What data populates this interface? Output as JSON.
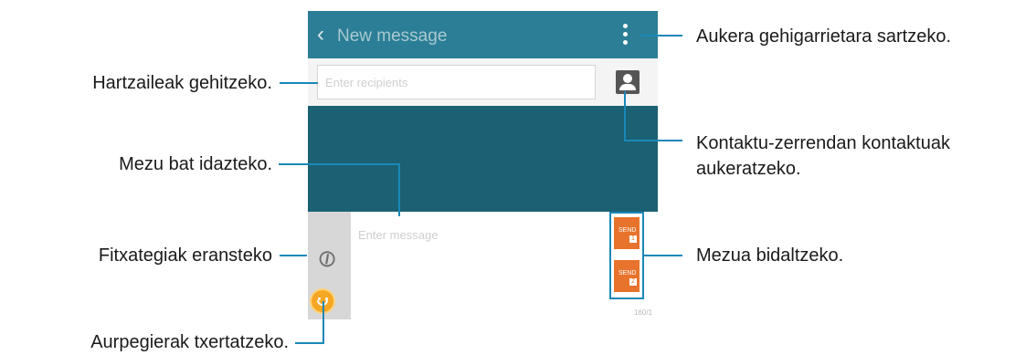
{
  "screen": {
    "title": "New message",
    "back_glyph": "‹",
    "recipients_placeholder": "Enter recipients",
    "message_placeholder": "Enter message",
    "char_counter": "160/1",
    "send_buttons": [
      {
        "label": "SEND",
        "sim": "1"
      },
      {
        "label": "SEND",
        "sim": "2"
      }
    ],
    "icons": [
      "back-icon",
      "more-options-icon",
      "contact-icon",
      "attach-icon",
      "emoticon-icon",
      "send-icon"
    ]
  },
  "callouts": {
    "more_options": "Aukera gehigarrietara sartzeko.",
    "add_recipients": "Hartzaileak gehitzeko.",
    "contacts_line1": "Kontaktu-zerrendan kontaktuak",
    "contacts_line2": "aukeratzeko.",
    "write_message": "Mezu bat idazteko.",
    "attach_files": "Fitxategiak eransteko",
    "send_message": "Mezua bidaltzeko.",
    "insert_emoticons": "Aurpegierak txertatzeko."
  },
  "colors": {
    "titlebar": "#2b7e95",
    "thread": "#1b6173",
    "send": "#e8732c",
    "callout": "#1a88b8"
  }
}
